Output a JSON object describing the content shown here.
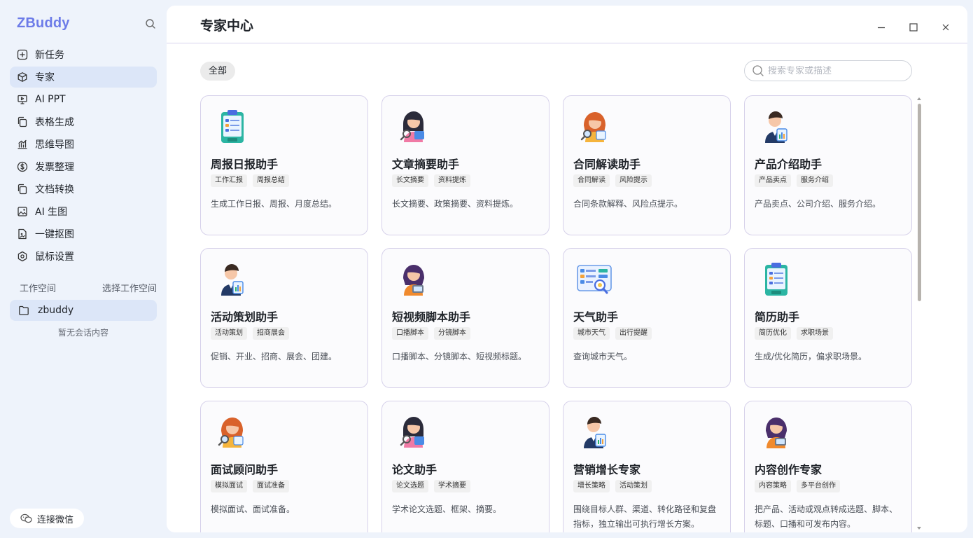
{
  "app": {
    "name": "ZBuddy"
  },
  "sidebar": {
    "items": [
      {
        "label": "新任务",
        "icon": "plus-square-icon"
      },
      {
        "label": "专家",
        "icon": "cube-icon",
        "active": true
      },
      {
        "label": "AI PPT",
        "icon": "presentation-icon"
      },
      {
        "label": "表格生成",
        "icon": "copy-icon"
      },
      {
        "label": "思维导图",
        "icon": "chart-icon"
      },
      {
        "label": "发票整理",
        "icon": "dollar-icon"
      },
      {
        "label": "文档转换",
        "icon": "copy-icon"
      },
      {
        "label": "AI 生图",
        "icon": "image-icon"
      },
      {
        "label": "一键抠图",
        "icon": "file-image-icon"
      },
      {
        "label": "鼠标设置",
        "icon": "settings-icon"
      }
    ],
    "workspace_label": "工作空间",
    "workspace_select": "选择工作空间",
    "workspace_current": "zbuddy",
    "empty_text": "暂无会话内容",
    "wechat_label": "连接微信"
  },
  "main": {
    "title": "专家中心",
    "filter": "全部",
    "search_placeholder": "搜索专家或描述",
    "cards": [
      {
        "name": "周报日报助手",
        "tags": [
          "工作汇报",
          "周报总结"
        ],
        "desc": "生成工作日报、周报、月度总结。",
        "avatar": "clipboard-avatar-icon"
      },
      {
        "name": "文章摘要助手",
        "tags": [
          "长文摘要",
          "资料提炼"
        ],
        "desc": "长文摘要、政策摘要、资料提炼。",
        "avatar": "woman-magnifier-avatar-icon"
      },
      {
        "name": "合同解读助手",
        "tags": [
          "合同解读",
          "风险提示"
        ],
        "desc": "合同条款解释、风险点提示。",
        "avatar": "woman-red-hair-avatar-icon"
      },
      {
        "name": "产品介绍助手",
        "tags": [
          "产品卖点",
          "服务介绍"
        ],
        "desc": "产品卖点、公司介绍、服务介绍。",
        "avatar": "man-clipboard-avatar-icon"
      },
      {
        "name": "活动策划助手",
        "tags": [
          "活动策划",
          "招商展会"
        ],
        "desc": "促销、开业、招商、展会、团建。",
        "avatar": "man-clipboard-avatar-icon"
      },
      {
        "name": "短视频脚本助手",
        "tags": [
          "口播脚本",
          "分镜脚本"
        ],
        "desc": "口播脚本、分镜脚本、短视频标题。",
        "avatar": "woman-tablet-avatar-icon"
      },
      {
        "name": "天气助手",
        "tags": [
          "城市天气",
          "出行提醒"
        ],
        "desc": "查询城市天气。",
        "avatar": "dashboard-search-avatar-icon"
      },
      {
        "name": "简历助手",
        "tags": [
          "简历优化",
          "求职场景"
        ],
        "desc": "生成/优化简历，偏求职场景。",
        "avatar": "clipboard-avatar-icon"
      },
      {
        "name": "面试顾问助手",
        "tags": [
          "模拟面试",
          "面试准备"
        ],
        "desc": "模拟面试、面试准备。",
        "avatar": "woman-red-hair-avatar-icon"
      },
      {
        "name": "论文助手",
        "tags": [
          "论文选题",
          "学术摘要"
        ],
        "desc": "学术论文选题、框架、摘要。",
        "avatar": "woman-magnifier-avatar-icon"
      },
      {
        "name": "营销增长专家",
        "tags": [
          "增长策略",
          "活动策划"
        ],
        "desc": "围绕目标人群、渠道、转化路径和复盘指标，独立输出可执行增长方案。",
        "avatar": "man-clipboard-avatar-icon"
      },
      {
        "name": "内容创作专家",
        "tags": [
          "内容策略",
          "多平台创作"
        ],
        "desc": "把产品、活动或观点转成选题、脚本、标题、口播和可发布内容。",
        "avatar": "woman-tablet-avatar-icon"
      }
    ]
  },
  "colors": {
    "brand": "#6c7be8",
    "sidebar_bg": "#eef3fb",
    "active_bg": "#dce6f8",
    "card_border": "#d6d1ea"
  }
}
